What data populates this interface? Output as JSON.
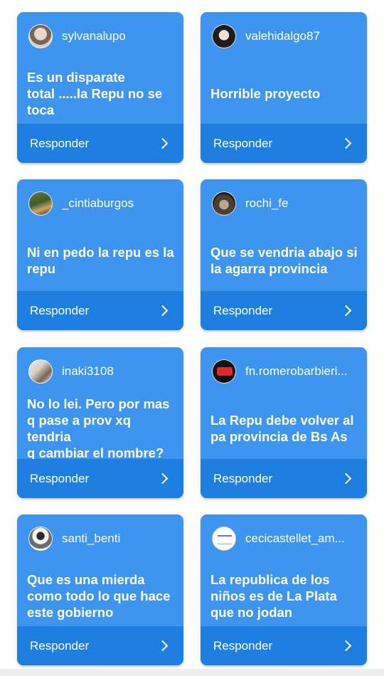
{
  "reply_label": "Responder",
  "cards": [
    {
      "username": "sylvanalupo",
      "comment": [
        "Es un disparate",
        "total .....la Repu no se",
        "toca"
      ],
      "avatar": "profile-photo"
    },
    {
      "username": "valehidalgo87",
      "comment": [
        "Horrible proyecto"
      ],
      "avatar": "profile-photo"
    },
    {
      "username": "_cintiaburgos",
      "comment": [
        "Ni en pedo la repu es la",
        "repu"
      ],
      "avatar": "profile-photo"
    },
    {
      "username": "rochi_fe",
      "comment": [
        "Que se vendria abajo si",
        "la agarra provincia"
      ],
      "avatar": "profile-photo"
    },
    {
      "username": "inaki3108",
      "comment": [
        "No lo lei. Pero por mas",
        "q pase a prov xq tendria",
        "q cambiar el nombre?"
      ],
      "avatar": "profile-photo"
    },
    {
      "username": "fn.romerobarbieri...",
      "comment": [
        "La Repu debe volver al",
        "pa provincia de Bs As"
      ],
      "avatar": "logo"
    },
    {
      "username": "santi_benti",
      "comment": [
        "Que es una mierda",
        "como todo lo que hace",
        "este gobierno"
      ],
      "avatar": "profile-photo"
    },
    {
      "username": "cecicastellet_am...",
      "comment": [
        "La republica de los",
        "niños es de La Plata",
        "que no jodan"
      ],
      "avatar": "logo"
    }
  ],
  "colors": {
    "card": "#3d95f0",
    "reply_bar": "#1f7fe0",
    "text": "#ffffff",
    "background": "#ffffff"
  }
}
